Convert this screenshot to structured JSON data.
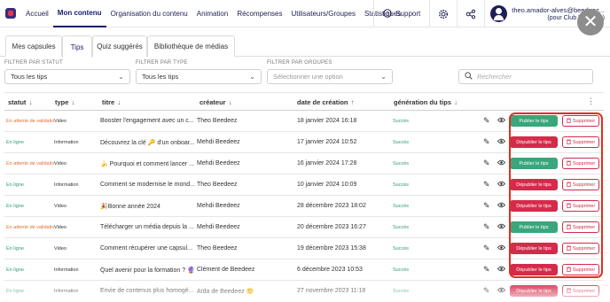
{
  "nav": {
    "items": [
      "Accueil",
      "Mon contenu",
      "Organisation du contenu",
      "Animation",
      "Récompenses",
      "Utilisateurs/Groupes",
      "Statistiques"
    ],
    "active": "Mon contenu",
    "support_label": "Support",
    "user_name": "theo.amador-alves@beedeez...",
    "user_club": "(pour Club Beedeez)"
  },
  "tabs": [
    "Mes capsules",
    "Tips",
    "Quiz suggérés",
    "Bibliothèque de médias"
  ],
  "active_tab": "Tips",
  "filters": {
    "statut": {
      "label": "FILTRER PAR STATUT",
      "value": "Tous les tips"
    },
    "type": {
      "label": "FILTRER PAR TYPE",
      "value": "Tous les tips"
    },
    "groupes": {
      "label": "FILTRER PAR GROUPES",
      "placeholder": "Sélectionner une option"
    },
    "search_placeholder": "Rechercher"
  },
  "table": {
    "headers": [
      "statut",
      "type",
      "titre",
      "créateur",
      "date de création",
      "génération du tips"
    ],
    "rows": [
      {
        "statut": "En attente de validatio",
        "statut_kind": "pending",
        "type": "Video",
        "titre": "Booster l'engagement avec un c...",
        "createur": "Theo Beedeez",
        "date": "18 janvier 2024 16:18",
        "generation": "Succès",
        "publish": "Publier le tips",
        "publish_kind": "green",
        "delete": "Supprimer"
      },
      {
        "statut": "En ligne",
        "statut_kind": "online",
        "type": "Information",
        "titre": "Découvrez la clé 🔑 d'un onboar...",
        "createur": "Mehdi Beedeez",
        "date": "17 janvier 2024 10:52",
        "generation": "Succès",
        "publish": "Dépublier le tips",
        "publish_kind": "red",
        "delete": "Supprimer"
      },
      {
        "statut": "En attente de validatio",
        "statut_kind": "pending",
        "type": "Video",
        "titre": "🍌 Pourquoi et comment lancer ...",
        "createur": "Mehdi Beedeez",
        "date": "16 janvier 2024 17:28",
        "generation": "Succès",
        "publish": "Publier le tips",
        "publish_kind": "green",
        "delete": "Supprimer"
      },
      {
        "statut": "En ligne",
        "statut_kind": "online",
        "type": "Information",
        "titre": "Comment se modernise le mond...",
        "createur": "Theo Beedeez",
        "date": "10 janvier 2024 10:09",
        "generation": "Succès",
        "publish": "Dépublier le tips",
        "publish_kind": "red",
        "delete": "Supprimer"
      },
      {
        "statut": "En ligne",
        "statut_kind": "online",
        "type": "Video",
        "titre": "🎉Bonne année 2024",
        "createur": "Mehdi Beedeez",
        "date": "28 décembre 2023 18:02",
        "generation": "Succès",
        "publish": "Dépublier le tips",
        "publish_kind": "red",
        "delete": "Supprimer"
      },
      {
        "statut": "En attente de validatio",
        "statut_kind": "pending",
        "type": "Video",
        "titre": "Télécharger un média depuis la ...",
        "createur": "Mehdi Beedeez",
        "date": "20 décembre 2023 16:27",
        "generation": "Succès",
        "publish": "Publier le tips",
        "publish_kind": "green",
        "delete": "Supprimer"
      },
      {
        "statut": "En ligne",
        "statut_kind": "online",
        "type": "Video",
        "titre": "Comment récupérer une capsul...",
        "createur": "Theo Beedeez",
        "date": "19 décembre 2023 15:38",
        "generation": "Succès",
        "publish": "Dépublier le tips",
        "publish_kind": "red",
        "delete": "Supprimer"
      },
      {
        "statut": "En ligne",
        "statut_kind": "online",
        "type": "Information",
        "titre": "Quel avenir pour la formation ? 🔮",
        "createur": "Clément de Beedeez",
        "date": "6 décembre 2023 10:53",
        "generation": "Succès",
        "publish": "Dépublier le tips",
        "publish_kind": "red",
        "delete": "Supprimer"
      },
      {
        "statut": "En ligne",
        "statut_kind": "online",
        "type": "Information",
        "titre": "Envie de contenus plus homogé...",
        "createur": "Aïda de Beedeez 🙂",
        "date": "27 novembre 2023 11:18",
        "generation": "Succès",
        "publish": "Dépublier le tips",
        "publish_kind": "red",
        "delete": "Supprimer"
      }
    ]
  },
  "colors": {
    "brand": "#1a1a6e",
    "publish": "#3aa67c",
    "unpublish": "#d42b4a",
    "online": "#2e9c6d",
    "pending": "#e2702f",
    "highlight": "#e0301e"
  }
}
